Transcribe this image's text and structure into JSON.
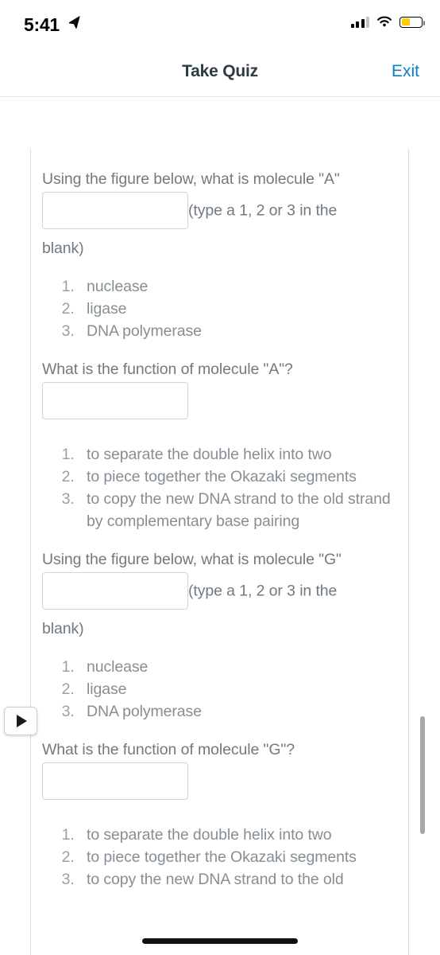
{
  "status_bar": {
    "time": "5:41",
    "location_icon": "location-arrow-icon",
    "signal_icon": "cellular-signal-icon",
    "wifi_icon": "wifi-icon",
    "battery_icon": "battery-low-power-icon",
    "battery_level_percent": 42,
    "battery_color": "#FFCC00"
  },
  "header": {
    "title": "Take Quiz",
    "exit_label": "Exit",
    "exit_color": "#0c7fc4",
    "title_color": "#2d3b45"
  },
  "quiz": {
    "questions": [
      {
        "prompt_before_input": "Using the figure below, what is molecule \"A\"",
        "input_value": "",
        "input_placeholder": "",
        "prompt_after_input": "(type a 1, 2 or 3 in the",
        "prompt_tail": "blank)",
        "choices": [
          "nuclease",
          "ligase",
          "DNA polymerase"
        ]
      },
      {
        "prompt_before_input": "What is the function of molecule \"A\"?",
        "input_value": "",
        "input_placeholder": "",
        "prompt_after_input": "",
        "prompt_tail": "",
        "choices": [
          "to separate the double helix into two",
          "to piece together the Okazaki segments",
          "to copy the new DNA strand to the old strand by complementary base pairing"
        ]
      },
      {
        "prompt_before_input": "Using the figure below, what is molecule \"G\"",
        "input_value": "",
        "input_placeholder": "",
        "prompt_after_input": "(type a 1, 2 or 3 in the",
        "prompt_tail": "blank)",
        "choices": [
          "nuclease",
          "ligase",
          "DNA polymerase"
        ]
      },
      {
        "prompt_before_input": "What is the function of molecule \"G\"?",
        "input_value": "",
        "input_placeholder": "",
        "prompt_after_input": "",
        "prompt_tail": "",
        "choices": [
          "to separate the double helix into two",
          "to piece together the Okazaki segments",
          "to copy the new DNA strand to the old"
        ]
      }
    ]
  },
  "controls": {
    "play_button_icon": "play-triangle-icon",
    "scrollbar_name": "vertical-scrollbar"
  },
  "colors": {
    "body_text": "#717a80",
    "choice_text": "#868e94",
    "border": "#dcdcdc"
  }
}
